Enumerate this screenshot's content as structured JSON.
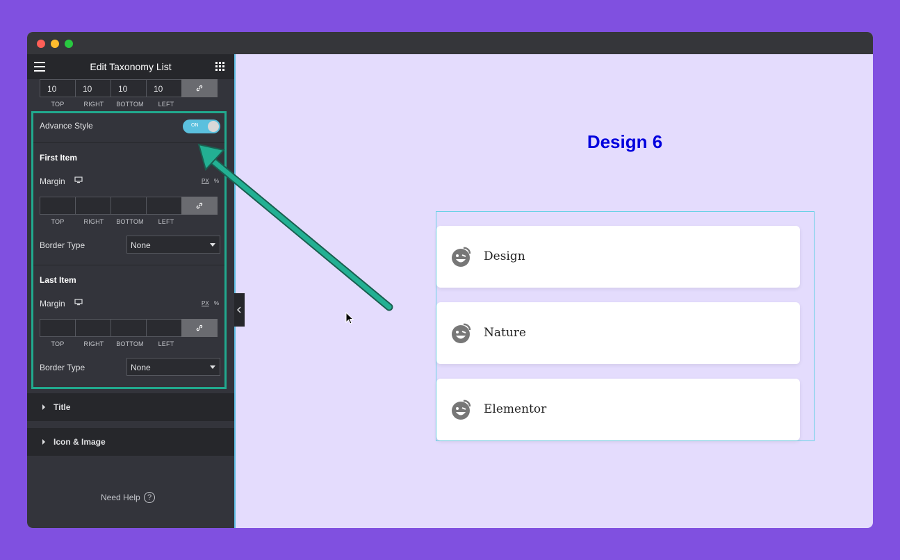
{
  "panel": {
    "title": "Edit Taxonomy List",
    "top_dimensions": {
      "values": [
        "10",
        "10",
        "10",
        "10"
      ],
      "labels": [
        "TOP",
        "RIGHT",
        "BOTTOM",
        "LEFT"
      ]
    },
    "advance_style": {
      "label": "Advance Style",
      "toggle_text": "ON",
      "state": "on"
    },
    "first_item": {
      "heading": "First Item",
      "margin_label": "Margin",
      "units": [
        "PX",
        "%"
      ],
      "dimension_labels": [
        "TOP",
        "RIGHT",
        "BOTTOM",
        "LEFT"
      ],
      "border_type_label": "Border Type",
      "border_type_value": "None"
    },
    "last_item": {
      "heading": "Last Item",
      "margin_label": "Margin",
      "units": [
        "PX",
        "%"
      ],
      "dimension_labels": [
        "TOP",
        "RIGHT",
        "BOTTOM",
        "LEFT"
      ],
      "border_type_label": "Border Type",
      "border_type_value": "None"
    },
    "sections": [
      "Title",
      "Icon & Image"
    ],
    "need_help": "Need Help",
    "help_glyph": "?"
  },
  "preview": {
    "heading": "Design 6",
    "items": [
      "Design",
      "Nature",
      "Elementor"
    ]
  },
  "colors": {
    "background": "#8050e0",
    "panel": "#33343b",
    "highlight": "#21a98e",
    "toggle": "#5bc0de",
    "heading": "#0000dd"
  },
  "icons": [
    "hamburger-icon",
    "grid-icon",
    "link-icon",
    "monitor-icon",
    "caret-down-icon",
    "chevron-left-icon",
    "emoji-icon",
    "question-icon"
  ]
}
